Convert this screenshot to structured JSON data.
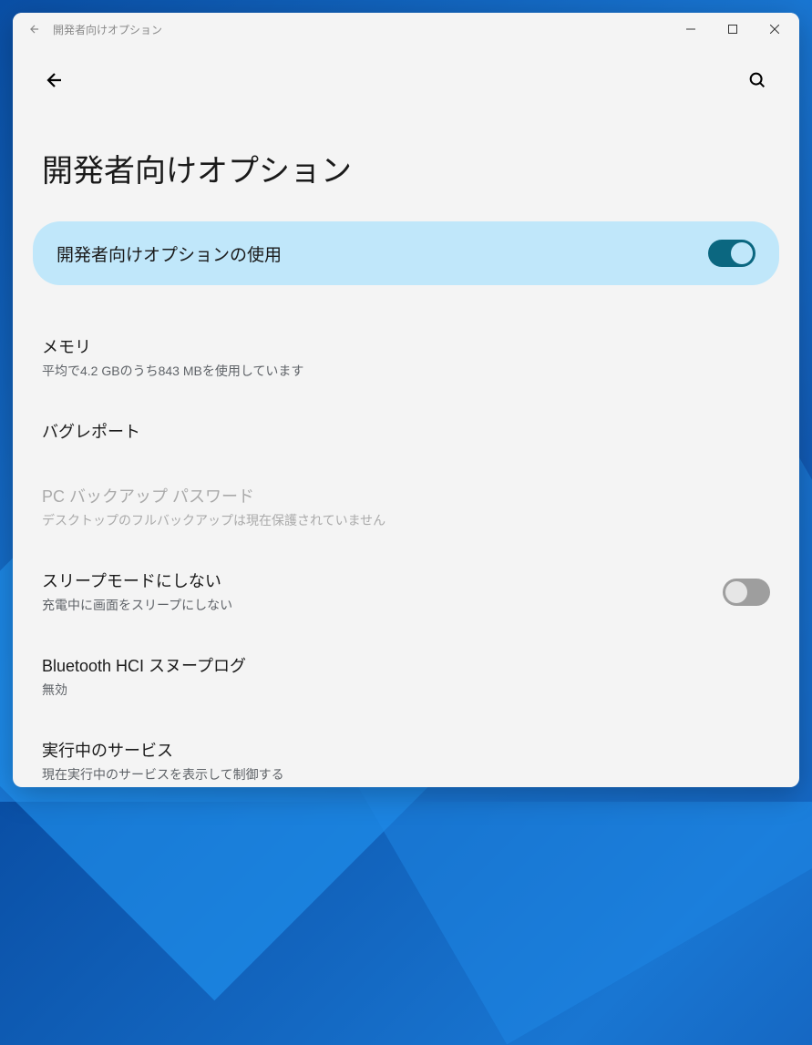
{
  "window": {
    "title": "開発者向けオプション"
  },
  "page": {
    "title": "開発者向けオプション"
  },
  "main_toggle": {
    "label": "開発者向けオプションの使用",
    "on": true
  },
  "rows": {
    "memory": {
      "title": "メモリ",
      "sub": "平均で4.2 GBのうち843 MBを使用しています"
    },
    "bugreport": {
      "title": "バグレポート"
    },
    "backup": {
      "title": "PC バックアップ パスワード",
      "sub": "デスクトップのフルバックアップは現在保護されていません"
    },
    "stayawake": {
      "title": "スリープモードにしない",
      "sub": "充電中に画面をスリープにしない",
      "on": false
    },
    "bluetooth": {
      "title": "Bluetooth HCI スヌープログ",
      "sub": "無効"
    },
    "services": {
      "title": "実行中のサービス",
      "sub": "現在実行中のサービスを表示して制御する"
    }
  }
}
